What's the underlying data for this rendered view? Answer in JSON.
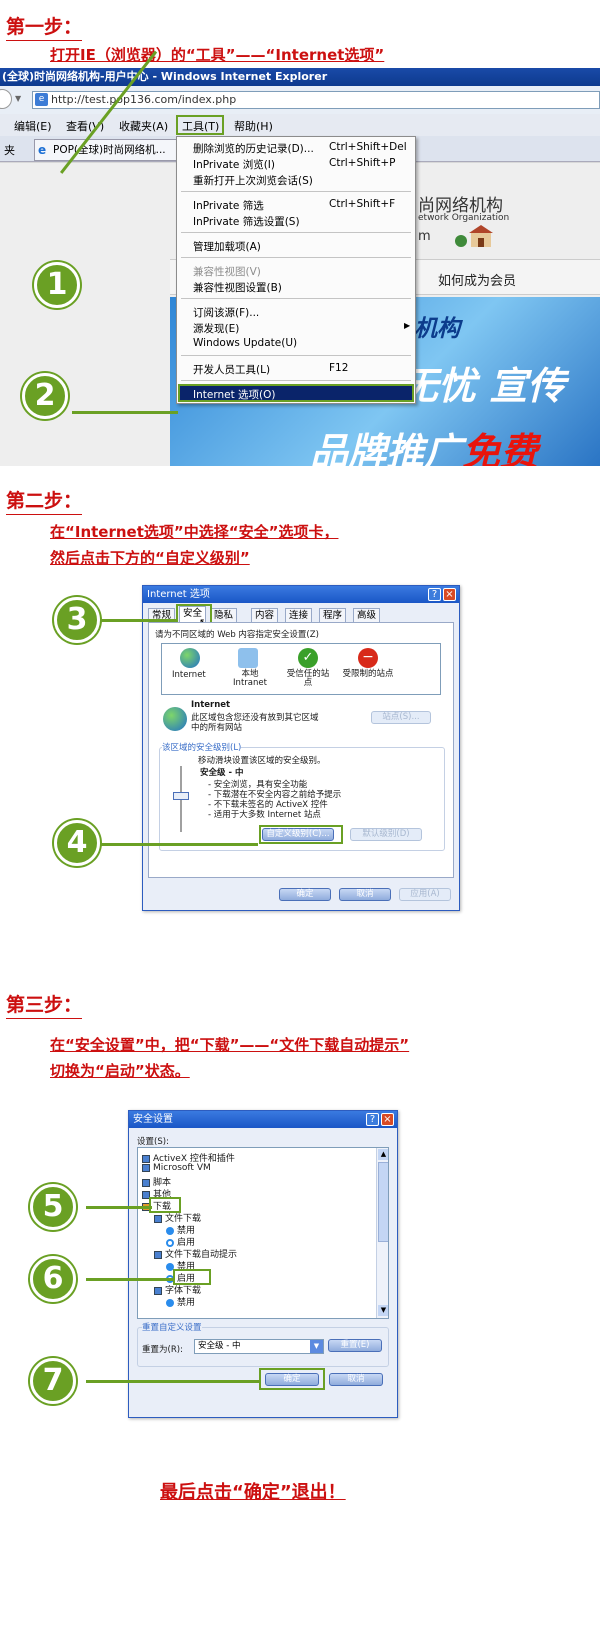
{
  "step1": {
    "label": "第一步：",
    "instruction": "打开IE（浏览器）的“工具”——“Internet选项”",
    "ie": {
      "window_title": "(全球)时尚网络机构-用户中心 - Windows Internet Explorer",
      "address": "http://test.pop136.com/index.php",
      "menus": [
        "编辑(E)",
        "查看(V)",
        "收藏夹(A)",
        "工具(T)",
        "帮助(H)"
      ],
      "fav_fragment": "夹",
      "tab_label": "POP(全球)时尚网络机...",
      "dropdown": [
        {
          "label": "删除浏览的历史记录(D)...",
          "shortcut": "Ctrl+Shift+Del"
        },
        {
          "label": "InPrivate 浏览(I)",
          "shortcut": "Ctrl+Shift+P"
        },
        {
          "label": "重新打开上次浏览会话(S)",
          "shortcut": ""
        },
        {
          "label": "InPrivate 筛选",
          "shortcut": "Ctrl+Shift+F"
        },
        {
          "label": "InPrivate 筛选设置(S)",
          "shortcut": ""
        },
        {
          "label": "管理加载项(A)",
          "shortcut": ""
        },
        {
          "label": "兼容性视图(V)",
          "shortcut": ""
        },
        {
          "label": "兼容性视图设置(B)",
          "shortcut": ""
        },
        {
          "label": "订阅该源(F)...",
          "shortcut": ""
        },
        {
          "label": "源发现(E)",
          "shortcut": ""
        },
        {
          "label": "Windows Update(U)",
          "shortcut": ""
        },
        {
          "label": "开发人员工具(L)",
          "shortcut": "F12"
        },
        {
          "label": "Internet 选项(O)",
          "shortcut": ""
        }
      ],
      "page": {
        "brand_cn": "尚网络机构",
        "brand_en": "etwork Organization",
        "brand_m": "m",
        "nav_member": "如何成为会员",
        "banner1": "机构",
        "banner2": "无忧 宣传",
        "banner3_a": "品牌推广",
        "banner3_b": "免费"
      }
    },
    "markers": [
      "1",
      "2"
    ]
  },
  "step2": {
    "label": "第二步：",
    "instruction_line1": "在“Internet选项”中选择“安全”选项卡，",
    "instruction_line2": "然后点击下方的“自定义级别”",
    "dialog": {
      "title": "Internet 选项",
      "tabs": [
        "常规",
        "安全",
        "隐私",
        "内容",
        "连接",
        "程序",
        "高级"
      ],
      "zone_prompt": "请为不同区域的 Web 内容指定安全设置(Z)",
      "zones": [
        "Internet",
        "本地 Intranet",
        "受信任的站点",
        "受限制的站点"
      ],
      "zone_name": "Internet",
      "zone_desc1": "此区域包含您还没有放到其它区域",
      "zone_desc2": "中的所有网站",
      "sites_button": "站点(S)...",
      "level_group": "该区域的安全级别(L)",
      "level_hint": "移动滑块设置该区域的安全级别。",
      "level_name": "安全级 - 中",
      "level_items": [
        "- 安全浏览，具有安全功能",
        "- 下载潜在不安全内容之前给予提示",
        "- 不下载未签名的 ActiveX 控件",
        "- 适用于大多数 Internet 站点"
      ],
      "custom_button": "自定义级别(C)...",
      "default_button": "默认级别(D)",
      "ok": "确定",
      "cancel": "取消",
      "apply": "应用(A)"
    },
    "markers": [
      "3",
      "4"
    ]
  },
  "step3": {
    "label": "第三步：",
    "instruction_line1": "在“安全设置”中，把“下载”——“文件下载自动提示”",
    "instruction_line2": "切换为“启动”状态。",
    "dialog": {
      "title": "安全设置",
      "settings_label": "设置(S):",
      "tree": [
        "ActiveX 控件和插件",
        "Microsoft VM",
        "脚本",
        "其他",
        "下载",
        "文件下载",
        "禁用",
        "启用",
        "文件下载自动提示",
        "禁用",
        "启用",
        "字体下载",
        "禁用"
      ],
      "reset_group": "重置自定义设置",
      "reset_label": "重置为(R):",
      "reset_value": "安全级 - 中",
      "reset_button": "重置(E)",
      "ok": "确定",
      "cancel": "取消"
    },
    "markers": [
      "5",
      "6",
      "7"
    ]
  },
  "final": "最后点击“确定”退出！"
}
